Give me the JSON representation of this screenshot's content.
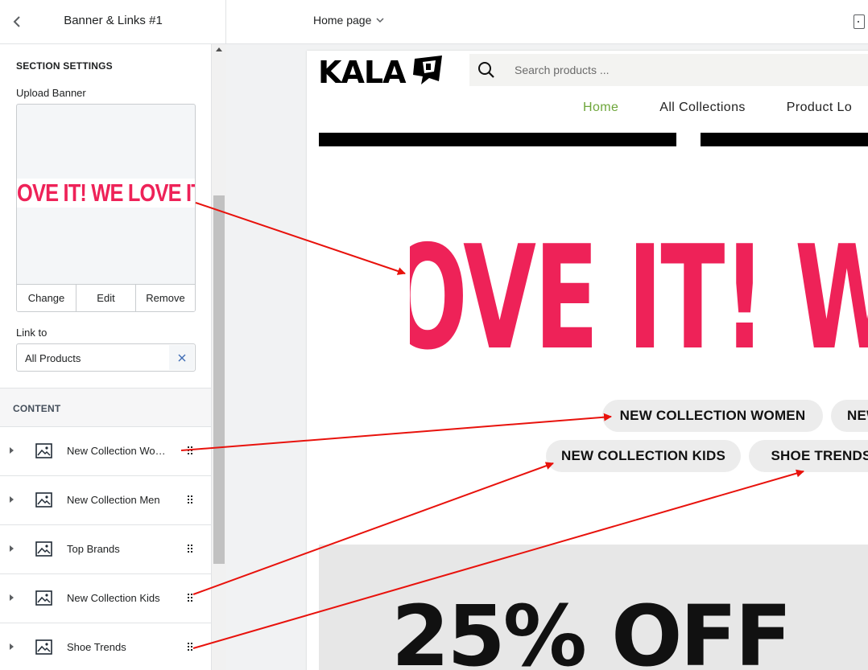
{
  "editor": {
    "panel_title": "Banner & Links #1",
    "page_selector": "Home page"
  },
  "sidebar": {
    "section_settings_heading": "SECTION SETTINGS",
    "upload_label": "Upload Banner",
    "banner_thumb_text": "OVE IT!   WE LOVE IT",
    "actions": {
      "change": "Change",
      "edit": "Edit",
      "remove": "Remove"
    },
    "link_label": "Link to",
    "link_value": "All Products",
    "content_heading": "CONTENT",
    "blocks": [
      {
        "label": "New Collection Women"
      },
      {
        "label": "New Collection Men"
      },
      {
        "label": "Top Brands"
      },
      {
        "label": "New Collection Kids"
      },
      {
        "label": "Shoe Trends"
      }
    ]
  },
  "store": {
    "logo_text": "KALA",
    "search_placeholder": "Search products ...",
    "nav": [
      "Home",
      "All Collections",
      "Product Lo"
    ],
    "active_nav": "Home",
    "banner_text": "OVE IT!   W",
    "pills": {
      "women": "NEW COLLECTION WOMEN",
      "men_partial": "NEW",
      "kids": "NEW COLLECTION KIDS",
      "shoes": "SHOE TRENDS"
    },
    "promo_text": "25% OFF"
  },
  "colors": {
    "banner_pink": "#ee2258",
    "nav_active": "#6ea63b",
    "arrow_red": "#e8120c"
  }
}
